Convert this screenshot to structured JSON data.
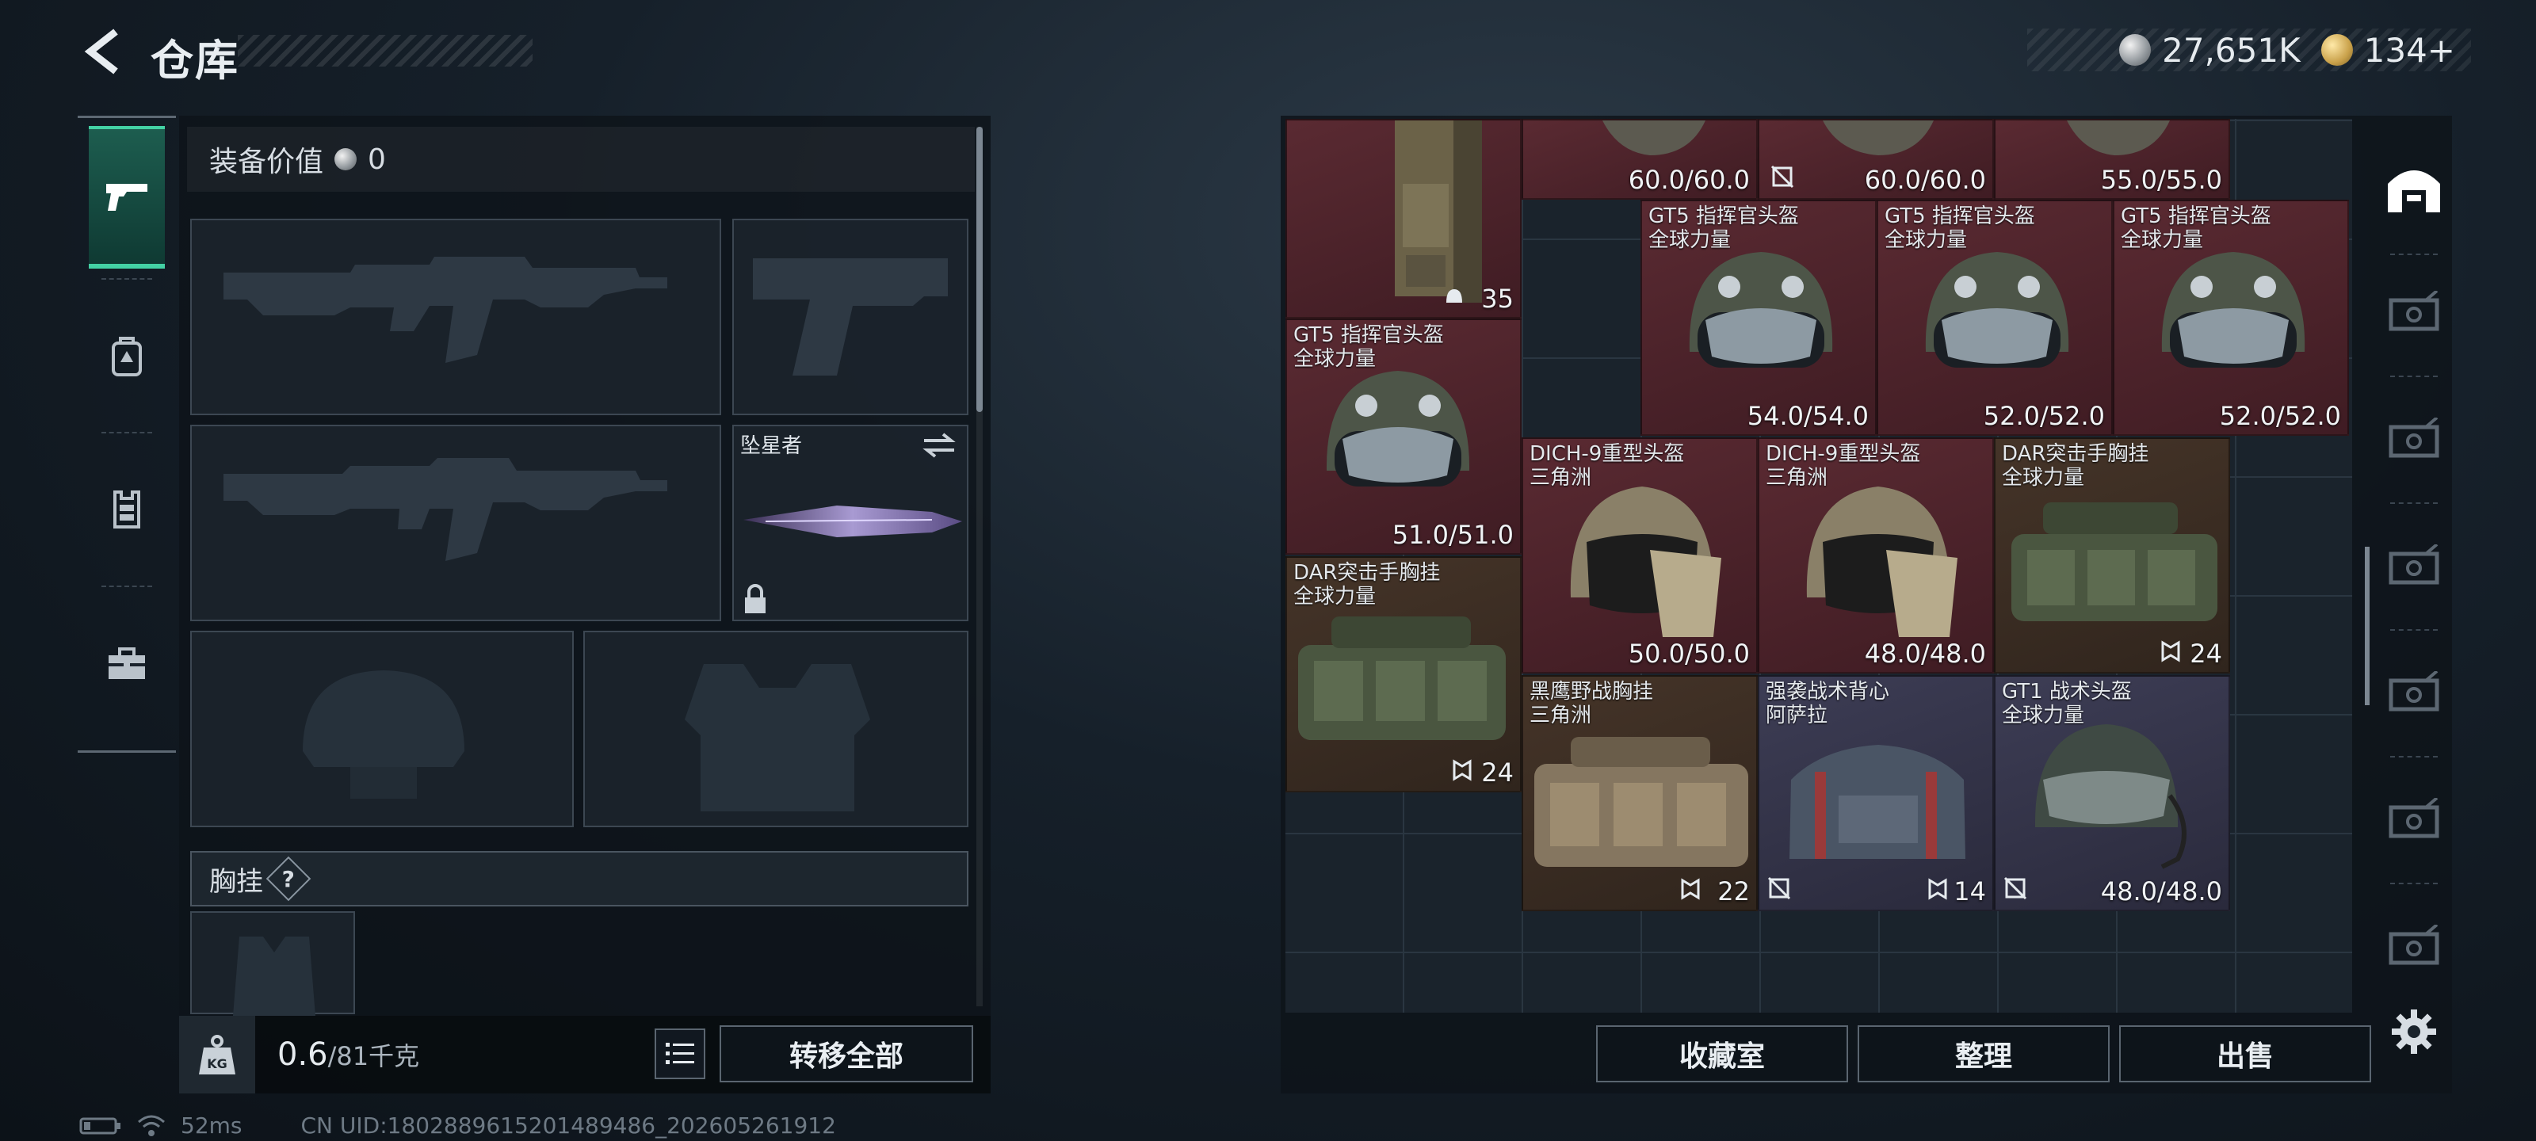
{
  "header": {
    "title": "仓库",
    "currency_primary": "27,651K",
    "currency_secondary": "134+"
  },
  "left_rail": {
    "items": [
      "pistol-icon",
      "backpack-icon",
      "vest-icon",
      "toolbox-icon"
    ],
    "active_index": 0
  },
  "loadout": {
    "value_label": "装备价值",
    "value": "0",
    "melee_slot_label": "坠星者",
    "chest_rig_label": "胸挂",
    "chest_rig_help": "?",
    "weight_current": "0.6",
    "weight_capacity": "/81千克",
    "weight_icon_text": "KG",
    "transfer_all": "转移全部"
  },
  "storage": {
    "items": [
      {
        "name": "",
        "value": "35",
        "tag": "helmet-count"
      },
      {
        "name": "",
        "value": "60.0/60.0"
      },
      {
        "name": "",
        "value": "60.0/60.0"
      },
      {
        "name": "",
        "value": "55.0/55.0"
      },
      {
        "name": "GT5 指挥官头盔\n全球力量",
        "value": "54.0/54.0"
      },
      {
        "name": "GT5 指挥官头盔\n全球力量",
        "value": "52.0/52.0"
      },
      {
        "name": "GT5 指挥官头盔\n全球力量",
        "value": "52.0/52.0"
      },
      {
        "name": "GT5 指挥官头盔\n全球力量",
        "value": "51.0/51.0"
      },
      {
        "name": "DICH-9重型头盔\n三角洲",
        "value": "50.0/50.0"
      },
      {
        "name": "DICH-9重型头盔\n三角洲",
        "value": "48.0/48.0"
      },
      {
        "name": "DAR突击手胸挂\n全球力量",
        "value": "24"
      },
      {
        "name": "DAR突击手胸挂\n全球力量",
        "value": "24"
      },
      {
        "name": "黑鹰野战胸挂\n三角洲",
        "value": "22"
      },
      {
        "name": "强袭战术背心\n阿萨拉",
        "value": "14"
      },
      {
        "name": "GT1 战术头盔\n全球力量",
        "value": "48.0/48.0"
      }
    ],
    "buttons": {
      "collection": "收藏室",
      "sort": "整理",
      "sell": "出售"
    }
  },
  "status": {
    "ping": "52ms",
    "uid": "CN UID:1802889615201489486_202605261912"
  },
  "colors": {
    "accent": "#43d1a4",
    "rarity_red": "#5a2a32",
    "rarity_brown": "#453428",
    "rarity_purple": "#3d3d55"
  }
}
